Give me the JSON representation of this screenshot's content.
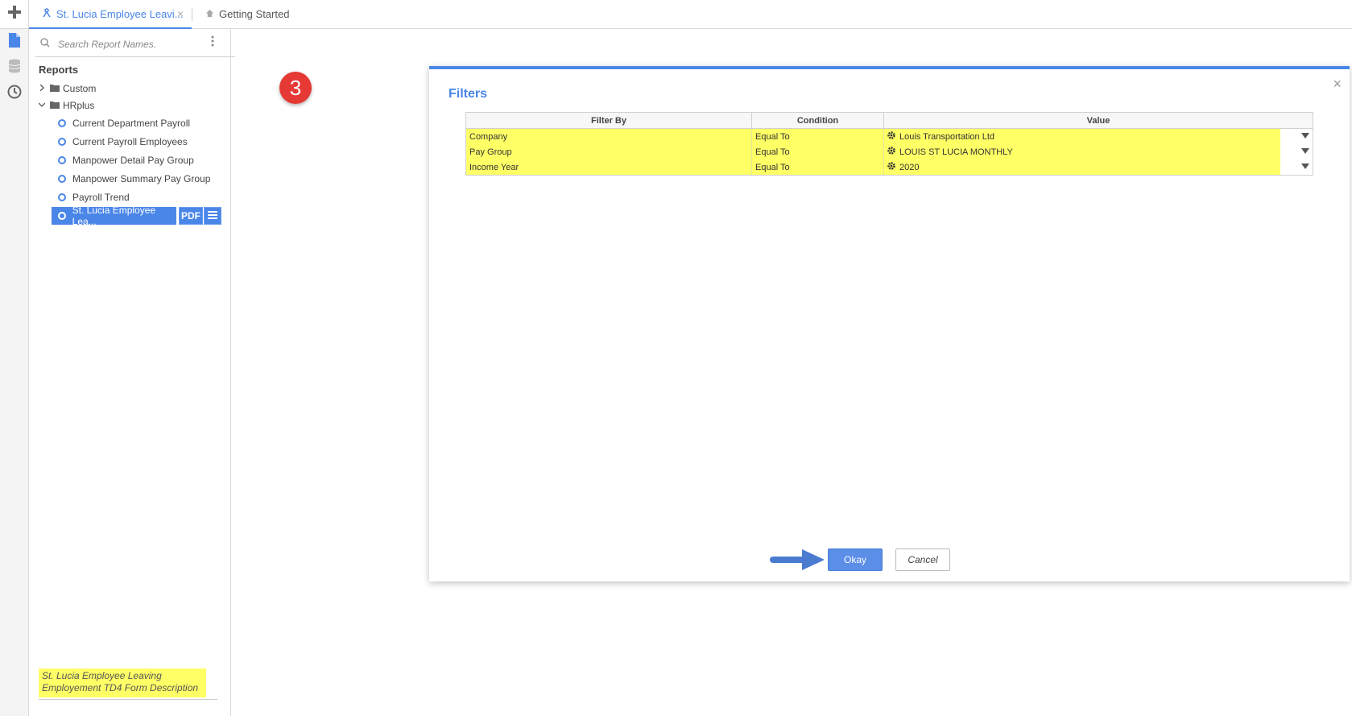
{
  "tabs": [
    {
      "label": "St. Lucia Employee Leavi...",
      "icon": "report-icon",
      "active": true
    },
    {
      "label": "Getting Started",
      "icon": "home-icon",
      "active": false
    }
  ],
  "search": {
    "placeholder": "Search Report Names."
  },
  "reports": {
    "heading": "Reports",
    "folders": [
      {
        "label": "Custom",
        "expanded": false
      },
      {
        "label": "HRplus",
        "expanded": true
      }
    ],
    "items": [
      {
        "label": "Current Department Payroll"
      },
      {
        "label": "Current Payroll Employees"
      },
      {
        "label": "Manpower Detail Pay Group"
      },
      {
        "label": "Manpower Summary Pay Group"
      },
      {
        "label": "Payroll Trend"
      },
      {
        "label": "St. Lucia Employee Lea..."
      }
    ],
    "pdf_label": "PDF",
    "description": "St. Lucia Employee Leaving Employement TD4 Form Description"
  },
  "step_number": "3",
  "dialog": {
    "title": "Filters",
    "columns": [
      "Filter By",
      "Condition",
      "Value"
    ],
    "rows": [
      {
        "filter_by": "Company",
        "condition": "Equal To",
        "value": "Louis Transportation Ltd"
      },
      {
        "filter_by": "Pay Group",
        "condition": "Equal To",
        "value": "LOUIS ST LUCIA MONTHLY"
      },
      {
        "filter_by": "Income Year",
        "condition": "Equal To",
        "value": "2020"
      }
    ],
    "okay_label": "Okay",
    "cancel_label": "Cancel"
  },
  "colors": {
    "accent": "#4a86e8",
    "highlight": "#ffff66",
    "step_badge": "#e53935"
  }
}
